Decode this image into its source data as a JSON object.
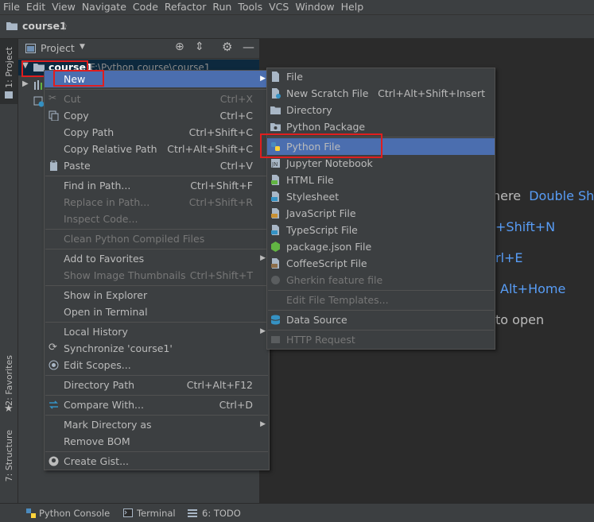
{
  "menubar": [
    "File",
    "Edit",
    "View",
    "Navigate",
    "Code",
    "Refactor",
    "Run",
    "Tools",
    "VCS",
    "Window",
    "Help"
  ],
  "navbar": {
    "crumb": "course1"
  },
  "side_tabs": {
    "project": "1: Project",
    "favorites": "2: Favorites",
    "structure": "7: Structure"
  },
  "project_panel": {
    "title": "Project",
    "root_name": "course1",
    "root_path": "F:\\Python course\\course1"
  },
  "editor_hints": {
    "h1_text": "here",
    "h1_key": "Double Shif",
    "h2_key": "+Shift+N",
    "h3_key": "rl+E",
    "h4_key": "Alt+Home",
    "h5_text": "to open"
  },
  "context_menu": {
    "new": "New",
    "items": [
      {
        "label": "Cut",
        "shortcut": "Ctrl+X",
        "disabled": true
      },
      {
        "label": "Copy",
        "shortcut": "Ctrl+C"
      },
      {
        "label": "Copy Path",
        "shortcut": "Ctrl+Shift+C"
      },
      {
        "label": "Copy Relative Path",
        "shortcut": "Ctrl+Alt+Shift+C"
      },
      {
        "label": "Paste",
        "shortcut": "Ctrl+V"
      },
      {
        "label": "Find in Path...",
        "shortcut": "Ctrl+Shift+F"
      },
      {
        "label": "Replace in Path...",
        "shortcut": "Ctrl+Shift+R",
        "disabled": true
      },
      {
        "label": "Inspect Code...",
        "shortcut": "",
        "disabled": true
      },
      {
        "label": "Clean Python Compiled Files",
        "shortcut": "",
        "disabled": true
      },
      {
        "label": "Add to Favorites",
        "shortcut": ""
      },
      {
        "label": "Show Image Thumbnails",
        "shortcut": "Ctrl+Shift+T",
        "disabled": true
      },
      {
        "label": "Show in Explorer",
        "shortcut": ""
      },
      {
        "label": "Open in Terminal",
        "shortcut": ""
      },
      {
        "label": "Local History",
        "shortcut": ""
      },
      {
        "label": "Synchronize 'course1'",
        "shortcut": ""
      },
      {
        "label": "Edit Scopes...",
        "shortcut": ""
      },
      {
        "label": "Directory Path",
        "shortcut": "Ctrl+Alt+F12"
      },
      {
        "label": "Compare With...",
        "shortcut": "Ctrl+D"
      },
      {
        "label": "Mark Directory as",
        "shortcut": ""
      },
      {
        "label": "Remove BOM",
        "shortcut": ""
      },
      {
        "label": "Create Gist...",
        "shortcut": ""
      }
    ]
  },
  "new_submenu": {
    "items": [
      {
        "label": "File",
        "shortcut": ""
      },
      {
        "label": "New Scratch File",
        "shortcut": "Ctrl+Alt+Shift+Insert"
      },
      {
        "label": "Directory",
        "shortcut": ""
      },
      {
        "label": "Python Package",
        "shortcut": ""
      },
      {
        "label": "Python File",
        "shortcut": ""
      },
      {
        "label": "Jupyter Notebook",
        "shortcut": ""
      },
      {
        "label": "HTML File",
        "shortcut": ""
      },
      {
        "label": "Stylesheet",
        "shortcut": ""
      },
      {
        "label": "JavaScript File",
        "shortcut": ""
      },
      {
        "label": "TypeScript File",
        "shortcut": ""
      },
      {
        "label": "package.json File",
        "shortcut": ""
      },
      {
        "label": "CoffeeScript File",
        "shortcut": ""
      },
      {
        "label": "Gherkin feature file",
        "shortcut": "",
        "disabled": true
      },
      {
        "label": "Edit File Templates...",
        "shortcut": "",
        "disabled": true
      },
      {
        "label": "Data Source",
        "shortcut": ""
      },
      {
        "label": "HTTP Request",
        "shortcut": "",
        "disabled": true
      }
    ]
  },
  "bottom_tabs": [
    "Python Console",
    "Terminal",
    "6: TODO"
  ],
  "colors": {
    "selection": "#4b6eaf",
    "highlight_box": "#e01e1e",
    "link": "#589df6"
  }
}
